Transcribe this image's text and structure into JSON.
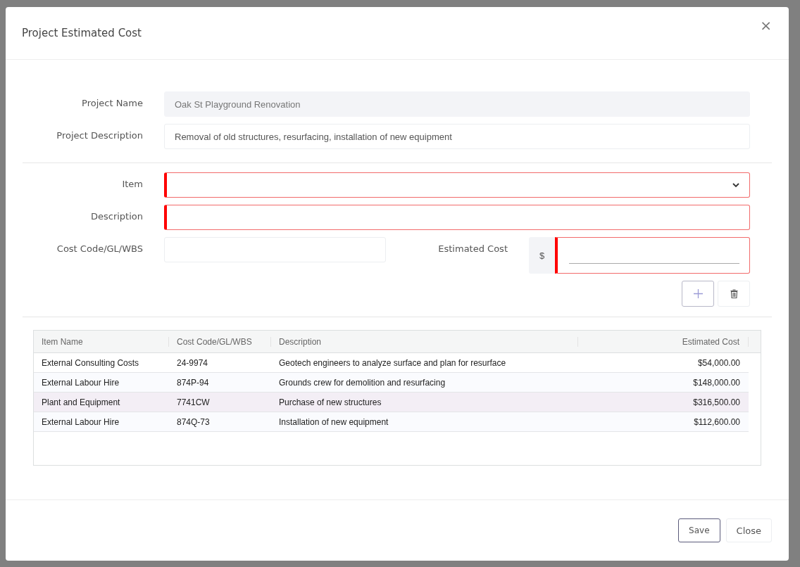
{
  "dialog": {
    "title": "Project Estimated Cost",
    "close_icon": "×"
  },
  "project": {
    "fields": [
      {
        "label": "Project Name",
        "value": "Oak St Playground Renovation",
        "disabled": true
      },
      {
        "label": "Project Description",
        "value": "Removal of old structures, resurfacing, installation of new equipment",
        "disabled": false
      }
    ]
  },
  "item_form": {
    "item": {
      "label": "Item",
      "invalid": true
    },
    "description": {
      "label": "Description",
      "invalid": true
    },
    "cost_code": {
      "label": "Cost Code/GL/WBS",
      "invalid": false
    },
    "estimated_cost": {
      "label": "Estimated Cost",
      "prefix": "$",
      "invalid": true
    }
  },
  "table": {
    "columns": [
      "Item Name",
      "Cost Code/GL/WBS",
      "Description",
      "Estimated Cost"
    ],
    "rows": [
      {
        "cells": [
          "External Consulting Costs",
          "24-9974",
          "Geotech engineers to analyze surface and plan for resurface",
          "$54,000.00"
        ],
        "selected": false
      },
      {
        "cells": [
          "External Labour Hire",
          "874P-94",
          "Grounds crew for demolition and resurfacing",
          "$148,000.00"
        ],
        "selected": false
      },
      {
        "cells": [
          "Plant and Equipment",
          "7741CW",
          "Purchase of new structures",
          "$316,500.00"
        ],
        "selected": true
      },
      {
        "cells": [
          "External Labour Hire",
          "874Q-73",
          "Installation of new equipment",
          "$112,600.00"
        ],
        "selected": false
      }
    ]
  },
  "footer": {
    "buttons": [
      "Save",
      "Close"
    ]
  }
}
